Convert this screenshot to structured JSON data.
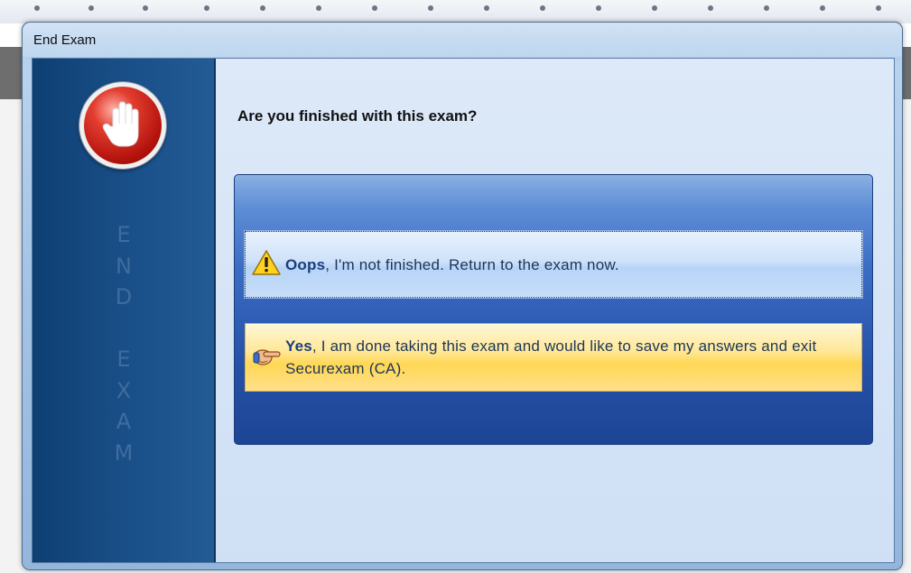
{
  "window": {
    "title": "End Exam"
  },
  "sidebar": {
    "icon": "stop-hand-icon",
    "vertical_text": [
      "E",
      "N",
      "D",
      "",
      "E",
      "X",
      "A",
      "M"
    ]
  },
  "main": {
    "question": "Are you finished with this exam?",
    "options": [
      {
        "icon": "warning-icon",
        "bold": "Oops",
        "text": ", I'm not finished. Return to the exam now."
      },
      {
        "icon": "pointing-hand-icon",
        "bold": "Yes",
        "text": ", I am done taking this exam and would like to save my answers and exit Securexam (CA)."
      }
    ]
  },
  "colors": {
    "sidebar": "#1a5089",
    "panel": "#2e5db5",
    "oops_button": "#cfe2fa",
    "yes_button": "#ffd755"
  }
}
